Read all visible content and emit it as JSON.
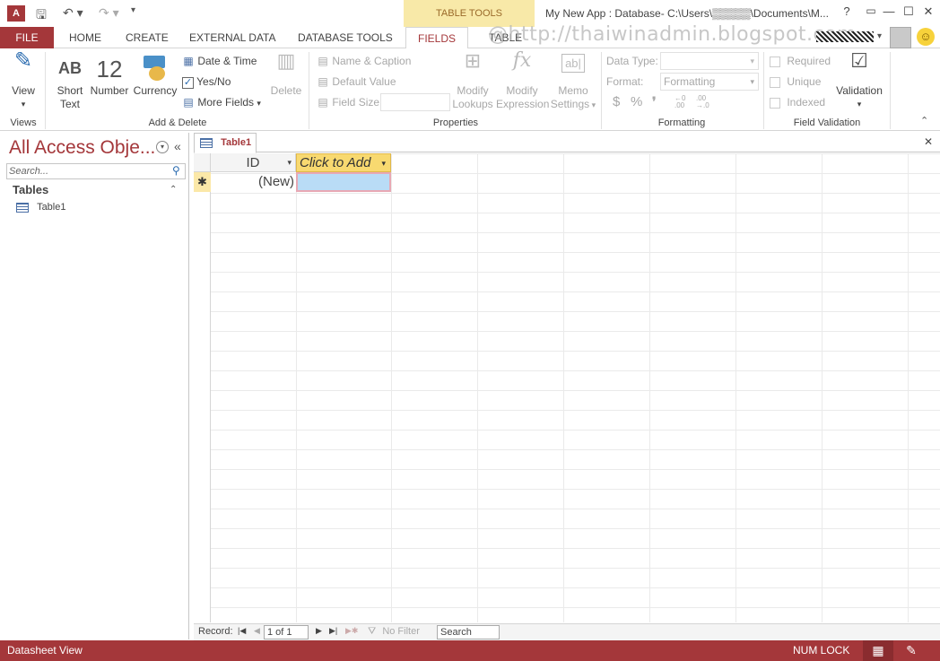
{
  "titlebar": {
    "app_icon": "access-logo-icon",
    "context_tab": "TABLE TOOLS",
    "window_title": "My New App : Database- C:\\Users\\▒▒▒▒▒\\Documents\\M...",
    "help": "?",
    "minimize": "—",
    "restore": "☐",
    "close": "✕"
  },
  "tabs": {
    "file": "FILE",
    "home": "HOME",
    "create": "CREATE",
    "external_data": "EXTERNAL DATA",
    "database_tools": "DATABASE TOOLS",
    "fields": "FIELDS",
    "table": "TABLE"
  },
  "watermark": "@http://thaiwinadmin.blogspot.com",
  "ribbon": {
    "views": {
      "view": "View",
      "group": "Views"
    },
    "add_delete": {
      "short_text_glyph": "AB",
      "short_text_1": "Short",
      "short_text_2": "Text",
      "number_glyph": "12",
      "number": "Number",
      "currency": "Currency",
      "date_time": "Date & Time",
      "yes_no": "Yes/No",
      "more_fields": "More Fields",
      "delete": "Delete",
      "group": "Add & Delete"
    },
    "properties": {
      "name_caption": "Name & Caption",
      "default_value": "Default Value",
      "field_size": "Field Size",
      "modify_lookups_1": "Modify",
      "modify_lookups_2": "Lookups",
      "modify_expression_1": "Modify",
      "modify_expression_2": "Expression",
      "memo_settings_1": "Memo",
      "memo_settings_2": "Settings",
      "group": "Properties"
    },
    "formatting": {
      "data_type_label": "Data Type:",
      "format_label": "Format:",
      "format_value": "Formatting",
      "currency_sym": "$",
      "percent_sym": "%",
      "comma_sym": "❜",
      "group": "Formatting"
    },
    "validation": {
      "required": "Required",
      "unique": "Unique",
      "indexed": "Indexed",
      "validation": "Validation",
      "group": "Field Validation"
    }
  },
  "nav": {
    "title": "All Access Obje...",
    "search_placeholder": "Search...",
    "section": "Tables",
    "items": [
      "Table1"
    ]
  },
  "document": {
    "tab": "Table1",
    "columns": [
      "ID",
      "Click to Add"
    ],
    "new_row_marker": "✱",
    "new_row_id": "(New)"
  },
  "recnav": {
    "record_label": "Record:",
    "record_value": "1 of 1",
    "filter": "No Filter",
    "search": "Search"
  },
  "status": {
    "left": "Datasheet View",
    "numlock": "NUM LOCK"
  },
  "colors": {
    "accent": "#a4373a",
    "context_tab": "#f8e9a8",
    "selected_cell": "#b9dcf6"
  }
}
